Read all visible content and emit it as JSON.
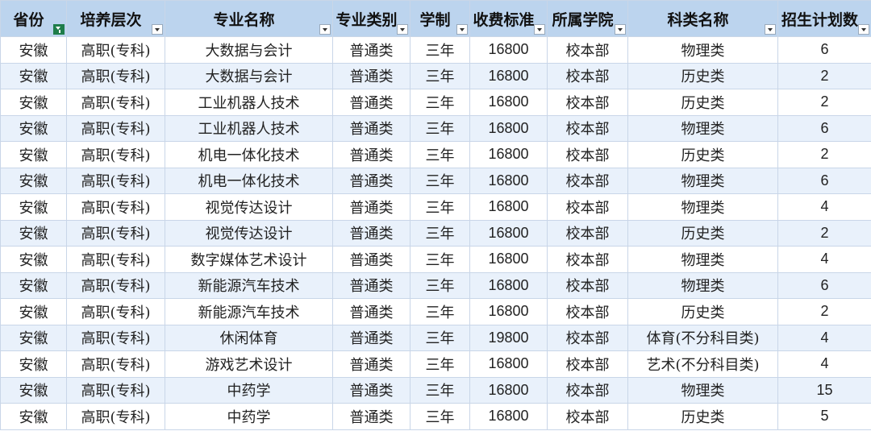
{
  "headers": [
    "省份",
    "培养层次",
    "专业名称",
    "专业类别",
    "学制",
    "收费标准",
    "所属学院",
    "科类名称",
    "招生计划数"
  ],
  "rows": [
    [
      "安徽",
      "高职(专科)",
      "大数据与会计",
      "普通类",
      "三年",
      "16800",
      "校本部",
      "物理类",
      "6"
    ],
    [
      "安徽",
      "高职(专科)",
      "大数据与会计",
      "普通类",
      "三年",
      "16800",
      "校本部",
      "历史类",
      "2"
    ],
    [
      "安徽",
      "高职(专科)",
      "工业机器人技术",
      "普通类",
      "三年",
      "16800",
      "校本部",
      "历史类",
      "2"
    ],
    [
      "安徽",
      "高职(专科)",
      "工业机器人技术",
      "普通类",
      "三年",
      "16800",
      "校本部",
      "物理类",
      "6"
    ],
    [
      "安徽",
      "高职(专科)",
      "机电一体化技术",
      "普通类",
      "三年",
      "16800",
      "校本部",
      "历史类",
      "2"
    ],
    [
      "安徽",
      "高职(专科)",
      "机电一体化技术",
      "普通类",
      "三年",
      "16800",
      "校本部",
      "物理类",
      "6"
    ],
    [
      "安徽",
      "高职(专科)",
      "视觉传达设计",
      "普通类",
      "三年",
      "16800",
      "校本部",
      "物理类",
      "4"
    ],
    [
      "安徽",
      "高职(专科)",
      "视觉传达设计",
      "普通类",
      "三年",
      "16800",
      "校本部",
      "历史类",
      "2"
    ],
    [
      "安徽",
      "高职(专科)",
      "数字媒体艺术设计",
      "普通类",
      "三年",
      "16800",
      "校本部",
      "物理类",
      "4"
    ],
    [
      "安徽",
      "高职(专科)",
      "新能源汽车技术",
      "普通类",
      "三年",
      "16800",
      "校本部",
      "物理类",
      "6"
    ],
    [
      "安徽",
      "高职(专科)",
      "新能源汽车技术",
      "普通类",
      "三年",
      "16800",
      "校本部",
      "历史类",
      "2"
    ],
    [
      "安徽",
      "高职(专科)",
      "休闲体育",
      "普通类",
      "三年",
      "19800",
      "校本部",
      "体育(不分科目类)",
      "4"
    ],
    [
      "安徽",
      "高职(专科)",
      "游戏艺术设计",
      "普通类",
      "三年",
      "16800",
      "校本部",
      "艺术(不分科目类)",
      "4"
    ],
    [
      "安徽",
      "高职(专科)",
      "中药学",
      "普通类",
      "三年",
      "16800",
      "校本部",
      "物理类",
      "15"
    ],
    [
      "安徽",
      "高职(专科)",
      "中药学",
      "普通类",
      "三年",
      "16800",
      "校本部",
      "历史类",
      "5"
    ]
  ],
  "active_filter_column": 0,
  "colors": {
    "header_bg": "#bcd4ee",
    "stripe_bg": "#e9f1fb",
    "filter_active": "#1e7d4a"
  }
}
